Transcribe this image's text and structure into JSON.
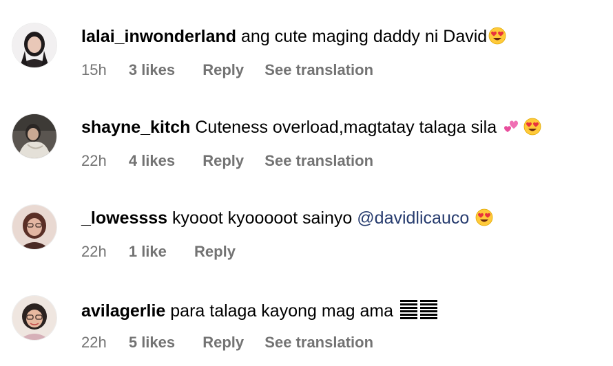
{
  "comments": [
    {
      "username": "lalai_inwonderland",
      "text": "ang cute maging daddy ni David",
      "time": "15h",
      "likes": "3 likes",
      "reply": "Reply",
      "translate": "See translation",
      "emojis": [
        "heart-eyes-emoji"
      ]
    },
    {
      "username": "shayne_kitch",
      "text": "Cuteness overload,magtatay talaga sila",
      "time": "22h",
      "likes": "4 likes",
      "reply": "Reply",
      "translate": "See translation",
      "emojis": [
        "two-hearts-emoji",
        "heart-eyes-emoji"
      ]
    },
    {
      "username": "_lowessss",
      "text": "kyooot kyooooot sainyo",
      "mention": "@davidlicauco",
      "time": "22h",
      "likes": "1 like",
      "reply": "Reply",
      "emojis": [
        "heart-eyes-emoji"
      ]
    },
    {
      "username": "avilagerlie",
      "text": "para talaga kayong mag ama",
      "time": "22h",
      "likes": "5 likes",
      "reply": "Reply",
      "translate": "See translation",
      "emojis": [
        "trigram-symbol"
      ]
    }
  ],
  "colors": {
    "text": "#000000",
    "meta": "#737373",
    "mention": "#263b6e",
    "emoji_face": "#ffca3a",
    "emoji_heart": "#e8333d"
  }
}
